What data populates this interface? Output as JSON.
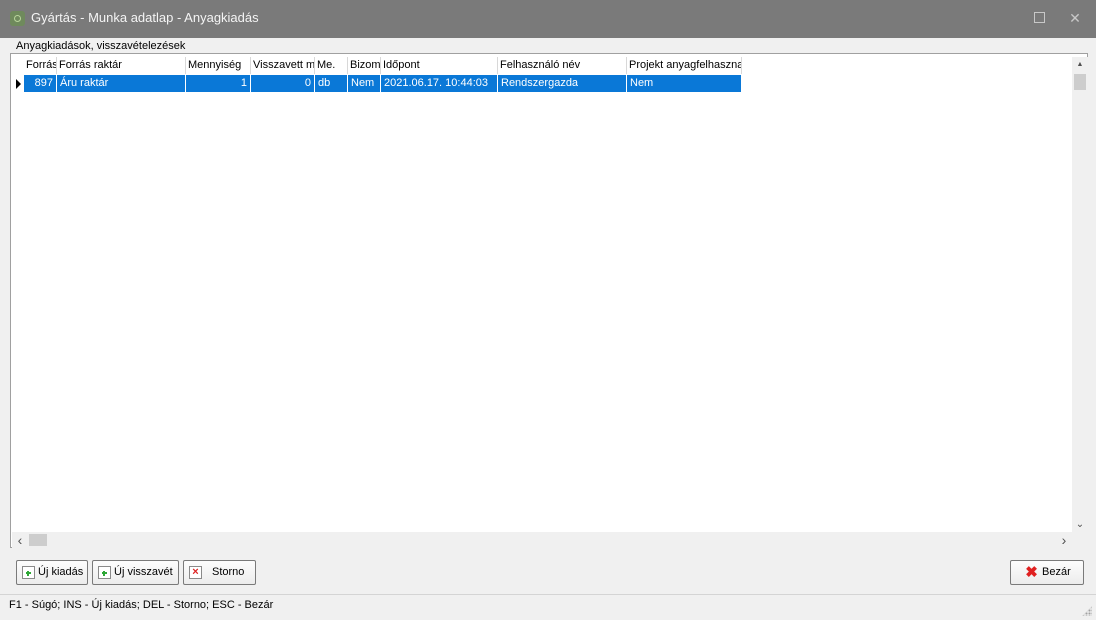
{
  "window": {
    "title": "Gyártás - Munka adatlap - Anyagkiadás",
    "icon": "app-icon",
    "maximize_icon": "maximize-icon",
    "close_icon": "close-icon",
    "close_glyph": "✕"
  },
  "group": {
    "label": "Anyagkiadások, visszavételezések"
  },
  "grid": {
    "columns": [
      "Forrás",
      "Forrás raktár",
      "Mennyiség",
      "Visszavett m",
      "Me.",
      "Bizoma",
      "Időpont",
      "Felhasználó név",
      "Projekt anyagfelhaszna"
    ],
    "rows": [
      {
        "selected": true,
        "cells": [
          "897",
          "Áru raktár",
          "1",
          "0",
          "db",
          "Nem",
          "2021.06.17. 10:44:03",
          "Rendszergazda",
          "Nem"
        ]
      }
    ],
    "scroll": {
      "up": "▲",
      "down": "⌄",
      "left": "‹",
      "right": "›"
    }
  },
  "buttons": {
    "new_issue": "Új kiadás",
    "new_return": "Új visszavét",
    "storno": "Storno",
    "close": "Bezár"
  },
  "statusbar": {
    "text": "F1 - Súgó; INS - Új kiadás; DEL - Storno; ESC - Bezár"
  },
  "colors": {
    "titlebar": "#7a7a7a",
    "selection": "#0a78d7",
    "add_icon": "#2ea836",
    "close_icon": "#e02020"
  }
}
